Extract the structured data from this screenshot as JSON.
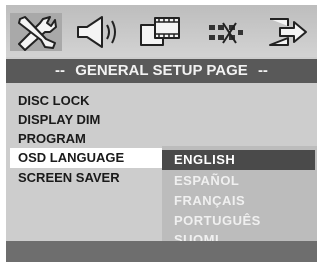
{
  "title": {
    "dash_left": "--",
    "text": "GENERAL SETUP PAGE",
    "dash_right": "--"
  },
  "icons": [
    {
      "name": "general-setup-icon",
      "selected": true
    },
    {
      "name": "audio-setup-icon",
      "selected": false
    },
    {
      "name": "video-setup-icon",
      "selected": false
    },
    {
      "name": "preference-setup-icon",
      "selected": false
    },
    {
      "name": "exit-setup-icon",
      "selected": false
    }
  ],
  "menu": {
    "items": [
      {
        "label": "DISC LOCK"
      },
      {
        "label": "DISPLAY DIM"
      },
      {
        "label": "PROGRAM"
      },
      {
        "label": "OSD LANGUAGE"
      },
      {
        "label": "SCREEN SAVER"
      }
    ],
    "selected_index": 3
  },
  "options": {
    "items": [
      {
        "label": "ENGLISH"
      },
      {
        "label": "ESPAÑOL"
      },
      {
        "label": "FRANÇAIS"
      },
      {
        "label": "PORTUGUÊS"
      },
      {
        "label": "SUOMI"
      }
    ],
    "selected_index": 0
  },
  "colors": {
    "title_bar": "#595959",
    "selected_option": "#4a4a4a",
    "panel": "#cdcdcd"
  }
}
